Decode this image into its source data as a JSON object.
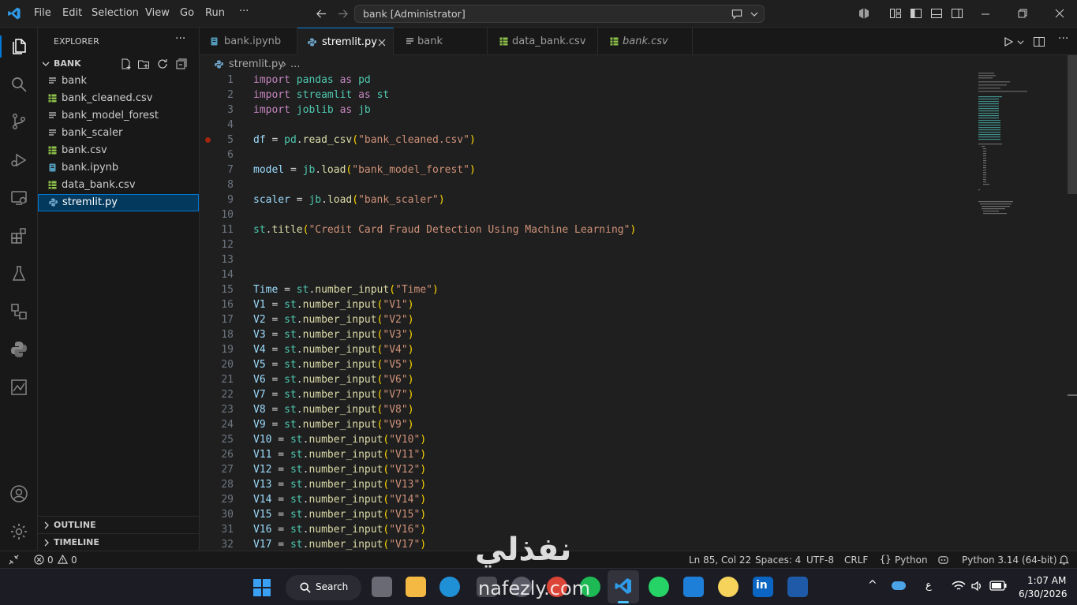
{
  "titlebar": {
    "menu": [
      "File",
      "Edit",
      "Selection",
      "View",
      "Go",
      "Run",
      "···"
    ],
    "search_text": "bank [Administrator]"
  },
  "sidebar": {
    "header": "EXPLORER",
    "folder": "BANK",
    "files": [
      {
        "name": "bank",
        "icon": "file-lines-icon"
      },
      {
        "name": "bank_cleaned.csv",
        "icon": "csv-table-icon"
      },
      {
        "name": "bank_model_forest",
        "icon": "file-lines-icon"
      },
      {
        "name": "bank_scaler",
        "icon": "file-lines-icon"
      },
      {
        "name": "bank.csv",
        "icon": "csv-table-icon"
      },
      {
        "name": "bank.ipynb",
        "icon": "notebook-icon"
      },
      {
        "name": "data_bank.csv",
        "icon": "csv-table-icon"
      },
      {
        "name": "stremlit.py",
        "icon": "python-icon"
      }
    ],
    "outline": "OUTLINE",
    "timeline": "TIMELINE"
  },
  "tabs": [
    {
      "label": "bank.ipynb",
      "active": false
    },
    {
      "label": "stremlit.py",
      "active": true
    },
    {
      "label": "bank",
      "active": false
    },
    {
      "label": "data_bank.csv",
      "active": false
    },
    {
      "label": "bank.csv",
      "active": false
    }
  ],
  "breadcrumb": {
    "file": "stremlit.py",
    "more": "..."
  },
  "code_lines": [
    [
      [
        "kw",
        "import"
      ],
      [
        "op",
        " "
      ],
      [
        "mod",
        "pandas"
      ],
      [
        "op",
        " "
      ],
      [
        "kw",
        "as"
      ],
      [
        "op",
        " "
      ],
      [
        "mod",
        "pd"
      ]
    ],
    [
      [
        "kw",
        "import"
      ],
      [
        "op",
        " "
      ],
      [
        "mod",
        "streamlit"
      ],
      [
        "op",
        " "
      ],
      [
        "kw",
        "as"
      ],
      [
        "op",
        " "
      ],
      [
        "mod",
        "st"
      ]
    ],
    [
      [
        "kw",
        "import"
      ],
      [
        "op",
        " "
      ],
      [
        "mod",
        "joblib"
      ],
      [
        "op",
        " "
      ],
      [
        "kw",
        "as"
      ],
      [
        "op",
        " "
      ],
      [
        "mod",
        "jb"
      ]
    ],
    [],
    [
      [
        "var",
        "df"
      ],
      [
        "op",
        " = "
      ],
      [
        "mod",
        "pd"
      ],
      [
        "op",
        "."
      ],
      [
        "fn",
        "read_csv"
      ],
      [
        "br",
        "("
      ],
      [
        "str",
        "\"bank_cleaned.csv\""
      ],
      [
        "br",
        ")"
      ]
    ],
    [],
    [
      [
        "var",
        "model"
      ],
      [
        "op",
        " = "
      ],
      [
        "mod",
        "jb"
      ],
      [
        "op",
        "."
      ],
      [
        "fn",
        "load"
      ],
      [
        "br",
        "("
      ],
      [
        "str",
        "\"bank_model_forest\""
      ],
      [
        "br",
        ")"
      ]
    ],
    [],
    [
      [
        "var",
        "scaler"
      ],
      [
        "op",
        " = "
      ],
      [
        "mod",
        "jb"
      ],
      [
        "op",
        "."
      ],
      [
        "fn",
        "load"
      ],
      [
        "br",
        "("
      ],
      [
        "str",
        "\"bank_scaler\""
      ],
      [
        "br",
        ")"
      ]
    ],
    [],
    [
      [
        "mod",
        "st"
      ],
      [
        "op",
        "."
      ],
      [
        "fn",
        "title"
      ],
      [
        "br",
        "("
      ],
      [
        "str",
        "\"Credit Card Fraud Detection Using Machine Learning\""
      ],
      [
        "br",
        ")"
      ]
    ],
    [],
    [],
    [],
    [
      [
        "var",
        "Time"
      ],
      [
        "op",
        " = "
      ],
      [
        "mod",
        "st"
      ],
      [
        "op",
        "."
      ],
      [
        "fn",
        "number_input"
      ],
      [
        "br",
        "("
      ],
      [
        "str",
        "\"Time\""
      ],
      [
        "br",
        ")"
      ]
    ],
    [
      [
        "var",
        "V1"
      ],
      [
        "op",
        " = "
      ],
      [
        "mod",
        "st"
      ],
      [
        "op",
        "."
      ],
      [
        "fn",
        "number_input"
      ],
      [
        "br",
        "("
      ],
      [
        "str",
        "\"V1\""
      ],
      [
        "br",
        ")"
      ]
    ],
    [
      [
        "var",
        "V2"
      ],
      [
        "op",
        " = "
      ],
      [
        "mod",
        "st"
      ],
      [
        "op",
        "."
      ],
      [
        "fn",
        "number_input"
      ],
      [
        "br",
        "("
      ],
      [
        "str",
        "\"V2\""
      ],
      [
        "br",
        ")"
      ]
    ],
    [
      [
        "var",
        "V3"
      ],
      [
        "op",
        " = "
      ],
      [
        "mod",
        "st"
      ],
      [
        "op",
        "."
      ],
      [
        "fn",
        "number_input"
      ],
      [
        "br",
        "("
      ],
      [
        "str",
        "\"V3\""
      ],
      [
        "br",
        ")"
      ]
    ],
    [
      [
        "var",
        "V4"
      ],
      [
        "op",
        " = "
      ],
      [
        "mod",
        "st"
      ],
      [
        "op",
        "."
      ],
      [
        "fn",
        "number_input"
      ],
      [
        "br",
        "("
      ],
      [
        "str",
        "\"V4\""
      ],
      [
        "br",
        ")"
      ]
    ],
    [
      [
        "var",
        "V5"
      ],
      [
        "op",
        " = "
      ],
      [
        "mod",
        "st"
      ],
      [
        "op",
        "."
      ],
      [
        "fn",
        "number_input"
      ],
      [
        "br",
        "("
      ],
      [
        "str",
        "\"V5\""
      ],
      [
        "br",
        ")"
      ]
    ],
    [
      [
        "var",
        "V6"
      ],
      [
        "op",
        " = "
      ],
      [
        "mod",
        "st"
      ],
      [
        "op",
        "."
      ],
      [
        "fn",
        "number_input"
      ],
      [
        "br",
        "("
      ],
      [
        "str",
        "\"V6\""
      ],
      [
        "br",
        ")"
      ]
    ],
    [
      [
        "var",
        "V7"
      ],
      [
        "op",
        " = "
      ],
      [
        "mod",
        "st"
      ],
      [
        "op",
        "."
      ],
      [
        "fn",
        "number_input"
      ],
      [
        "br",
        "("
      ],
      [
        "str",
        "\"V7\""
      ],
      [
        "br",
        ")"
      ]
    ],
    [
      [
        "var",
        "V8"
      ],
      [
        "op",
        " = "
      ],
      [
        "mod",
        "st"
      ],
      [
        "op",
        "."
      ],
      [
        "fn",
        "number_input"
      ],
      [
        "br",
        "("
      ],
      [
        "str",
        "\"V8\""
      ],
      [
        "br",
        ")"
      ]
    ],
    [
      [
        "var",
        "V9"
      ],
      [
        "op",
        " = "
      ],
      [
        "mod",
        "st"
      ],
      [
        "op",
        "."
      ],
      [
        "fn",
        "number_input"
      ],
      [
        "br",
        "("
      ],
      [
        "str",
        "\"V9\""
      ],
      [
        "br",
        ")"
      ]
    ],
    [
      [
        "var",
        "V10"
      ],
      [
        "op",
        " = "
      ],
      [
        "mod",
        "st"
      ],
      [
        "op",
        "."
      ],
      [
        "fn",
        "number_input"
      ],
      [
        "br",
        "("
      ],
      [
        "str",
        "\"V10\""
      ],
      [
        "br",
        ")"
      ]
    ],
    [
      [
        "var",
        "V11"
      ],
      [
        "op",
        " = "
      ],
      [
        "mod",
        "st"
      ],
      [
        "op",
        "."
      ],
      [
        "fn",
        "number_input"
      ],
      [
        "br",
        "("
      ],
      [
        "str",
        "\"V11\""
      ],
      [
        "br",
        ")"
      ]
    ],
    [
      [
        "var",
        "V12"
      ],
      [
        "op",
        " = "
      ],
      [
        "mod",
        "st"
      ],
      [
        "op",
        "."
      ],
      [
        "fn",
        "number_input"
      ],
      [
        "br",
        "("
      ],
      [
        "str",
        "\"V12\""
      ],
      [
        "br",
        ")"
      ]
    ],
    [
      [
        "var",
        "V13"
      ],
      [
        "op",
        " = "
      ],
      [
        "mod",
        "st"
      ],
      [
        "op",
        "."
      ],
      [
        "fn",
        "number_input"
      ],
      [
        "br",
        "("
      ],
      [
        "str",
        "\"V13\""
      ],
      [
        "br",
        ")"
      ]
    ],
    [
      [
        "var",
        "V14"
      ],
      [
        "op",
        " = "
      ],
      [
        "mod",
        "st"
      ],
      [
        "op",
        "."
      ],
      [
        "fn",
        "number_input"
      ],
      [
        "br",
        "("
      ],
      [
        "str",
        "\"V14\""
      ],
      [
        "br",
        ")"
      ]
    ],
    [
      [
        "var",
        "V15"
      ],
      [
        "op",
        " = "
      ],
      [
        "mod",
        "st"
      ],
      [
        "op",
        "."
      ],
      [
        "fn",
        "number_input"
      ],
      [
        "br",
        "("
      ],
      [
        "str",
        "\"V15\""
      ],
      [
        "br",
        ")"
      ]
    ],
    [
      [
        "var",
        "V16"
      ],
      [
        "op",
        " = "
      ],
      [
        "mod",
        "st"
      ],
      [
        "op",
        "."
      ],
      [
        "fn",
        "number_input"
      ],
      [
        "br",
        "("
      ],
      [
        "str",
        "\"V16\""
      ],
      [
        "br",
        ")"
      ]
    ],
    [
      [
        "var",
        "V17"
      ],
      [
        "op",
        " = "
      ],
      [
        "mod",
        "st"
      ],
      [
        "op",
        "."
      ],
      [
        "fn",
        "number_input"
      ],
      [
        "br",
        "("
      ],
      [
        "str",
        "\"V17\""
      ],
      [
        "br",
        ")"
      ]
    ]
  ],
  "statusbar": {
    "errors": "0",
    "warnings": "0",
    "position": "Ln 85, Col 22",
    "spaces": "Spaces: 4",
    "encoding": "UTF-8",
    "eol": "CRLF",
    "language": "Python",
    "interpreter": "Python 3.14 (64-bit)"
  },
  "taskbar": {
    "search": "Search",
    "time": "1:07 AM",
    "date": "6/30/2026",
    "lang": "ع"
  },
  "watermark": "نفذلي nafezly.com",
  "colors": {
    "accent": "#0078d4",
    "active_tab_top": "#0078d4",
    "selection": "#04395e"
  }
}
